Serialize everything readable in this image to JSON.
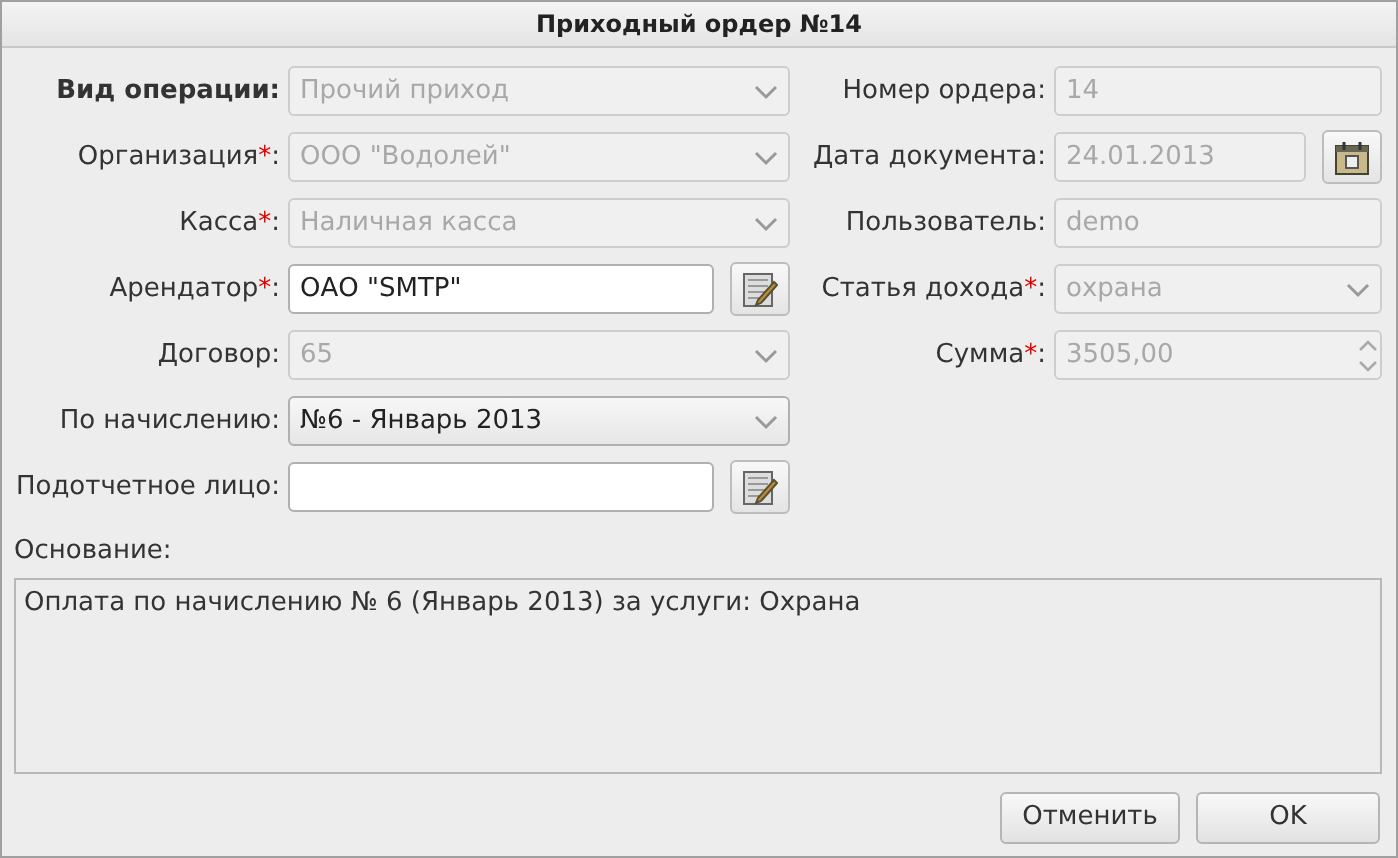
{
  "window": {
    "title": "Приходный ордер №14"
  },
  "left_fields": [
    {
      "label": "Вид операции:",
      "bold": true,
      "kind": "select",
      "value": "Прочий приход",
      "disabled": true
    },
    {
      "label": "Организация",
      "required_mark": "*",
      "label_end": ":",
      "kind": "select",
      "value": "ООО \"Водолей\"",
      "disabled": true
    },
    {
      "label": "Касса",
      "required_mark": "*",
      "label_end": ":",
      "kind": "select",
      "value": "Наличная касса",
      "disabled": true
    },
    {
      "label": "Арендатор",
      "required_mark": "*",
      "label_end": ":",
      "kind": "text",
      "value": "ОАО \"SMTP\"",
      "disabled": false,
      "action_button": {
        "kind": "edit"
      }
    },
    {
      "label": "Договор:",
      "kind": "select",
      "value": "65",
      "disabled": true
    },
    {
      "label": "По начислению:",
      "kind": "select",
      "value": "№6 - Январь 2013",
      "disabled": false
    },
    {
      "label": "Подотчетное лицо:",
      "kind": "text",
      "disabled": false,
      "action_button": {
        "kind": "edit"
      }
    }
  ],
  "right_fields": [
    {
      "label": "Номер ордера:",
      "kind": "text",
      "value": "14",
      "disabled": true
    },
    {
      "label": "Дата документа:",
      "kind": "text",
      "value": "24.01.2013",
      "disabled": true,
      "action_button": {
        "kind": "calendar"
      }
    },
    {
      "label": "Пользователь:",
      "kind": "text",
      "value": "demo",
      "disabled": true
    },
    {
      "label": "Статья дохода",
      "required_mark": "*",
      "label_end": ":",
      "kind": "select",
      "value": "охрана",
      "disabled": true
    },
    {
      "label": "Сумма",
      "required_mark": "*",
      "label_end": ":",
      "kind": "spin",
      "value": "3505,00",
      "disabled": true
    }
  ],
  "basis": {
    "label": "Основание:",
    "value": "Оплата по начислению № 6 (Январь 2013) за услуги: Охрана"
  },
  "buttons": [
    {
      "label": "Отменить"
    },
    {
      "label": "OK"
    }
  ]
}
